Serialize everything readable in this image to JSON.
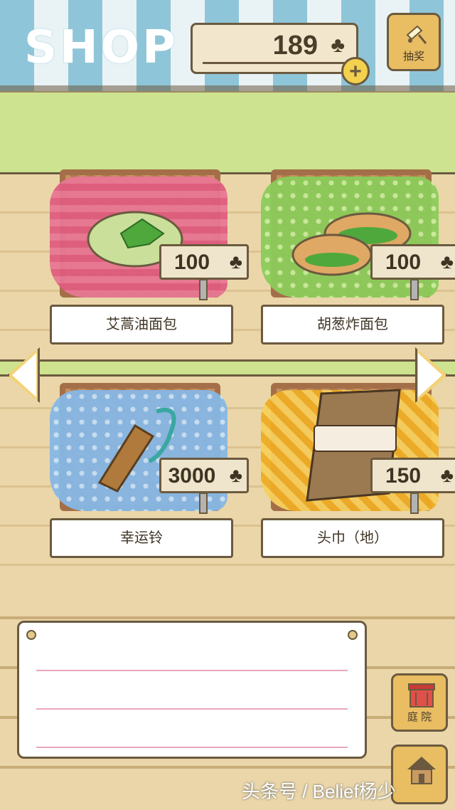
{
  "header": {
    "title": "SHOP",
    "currency_value": "189",
    "currency_icon": "♣",
    "add_currency_label": "+",
    "gacha_label": "抽奖"
  },
  "items": [
    {
      "name": "艾蒿油面包",
      "price": "100",
      "cloth_color": "#f2a6bd"
    },
    {
      "name": "胡葱炸面包",
      "price": "100",
      "cloth_color": "#9fd36f"
    },
    {
      "name": "幸运铃",
      "price": "3000",
      "cloth_color": "#8fc0e8"
    },
    {
      "name": "头巾（地）",
      "price": "150",
      "cloth_color": "#f5c143"
    }
  ],
  "desc_panel": {
    "text": ""
  },
  "side_buttons": {
    "yard_label": "庭 院"
  },
  "watermark": "头条号 / Belief杨少",
  "colors": {
    "outline": "#6b5a3f",
    "button_fill": "#e9bd62",
    "awning_blue": "#8fc5d8",
    "green_band": "#cde38f"
  }
}
